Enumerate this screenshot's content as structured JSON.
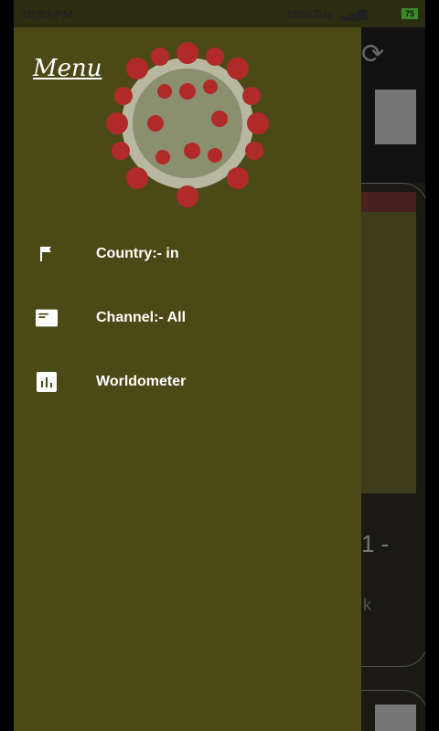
{
  "status": {
    "time": "10:53 PM",
    "speed": "196KB/s",
    "battery": "75"
  },
  "background": {
    "card_text1": "1 -",
    "card_text2": "k"
  },
  "drawer": {
    "title": "Menu",
    "items": [
      {
        "label": "Country:- in",
        "icon": "flag-icon"
      },
      {
        "label": "Channel:- All",
        "icon": "article-icon"
      },
      {
        "label": "Worldometer",
        "icon": "bar-chart-icon"
      }
    ]
  }
}
